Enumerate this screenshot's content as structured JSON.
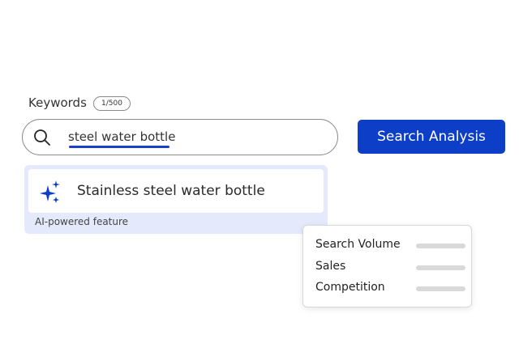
{
  "keywords": {
    "label": "Keywords",
    "count": "1/500"
  },
  "search": {
    "value": "steel water bottle",
    "button_label": "Search Analysis"
  },
  "suggestion": {
    "text": "Stainless steel water bottle",
    "note": "AI-powered feature",
    "icon": "sparkle-icon"
  },
  "metrics": [
    {
      "label": "Search Volume"
    },
    {
      "label": "Sales"
    },
    {
      "label": "Competition"
    }
  ],
  "colors": {
    "accent": "#0d3ec8",
    "suggestion_bg": "#e5e9fc",
    "placeholder_bar": "#d9d9d9"
  }
}
